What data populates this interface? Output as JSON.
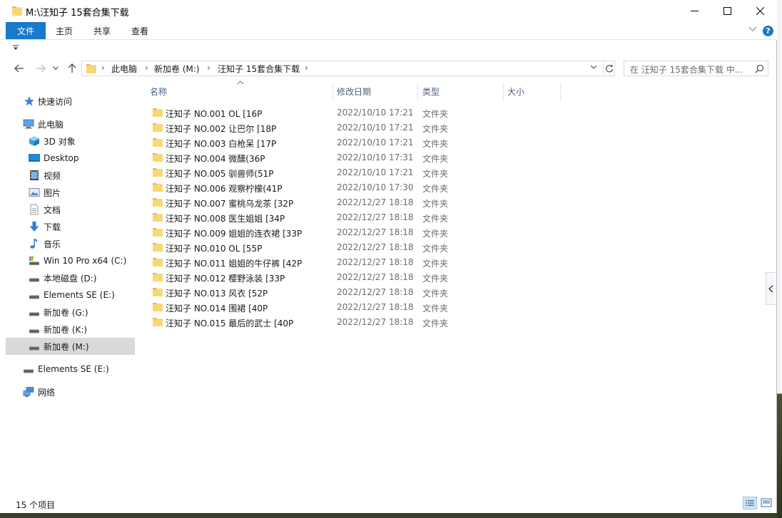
{
  "window": {
    "title": "M:\\汪知子 15套合集下载",
    "controls": {
      "minimize": "minimize",
      "maximize": "maximize",
      "close": "close"
    }
  },
  "ribbon": {
    "tabs": [
      "文件",
      "主页",
      "共享",
      "查看"
    ],
    "help": "?"
  },
  "address": {
    "crumbs": [
      "此电脑",
      "新加卷 (M:)",
      "汪知子 15套合集下载"
    ],
    "separator": "›"
  },
  "search": {
    "placeholder": "在 汪知子 15套合集下载 中..."
  },
  "sidebar": {
    "items": [
      {
        "label": "快速访问",
        "icon": "star-icon"
      },
      {
        "label": "此电脑",
        "icon": "computer-icon"
      },
      {
        "label": "3D 对象",
        "icon": "cube-icon"
      },
      {
        "label": "Desktop",
        "icon": "desktop-icon"
      },
      {
        "label": "视频",
        "icon": "video-icon"
      },
      {
        "label": "图片",
        "icon": "picture-icon"
      },
      {
        "label": "文档",
        "icon": "document-icon"
      },
      {
        "label": "下载",
        "icon": "download-icon"
      },
      {
        "label": "音乐",
        "icon": "music-icon"
      },
      {
        "label": "Win 10 Pro x64 (C:)",
        "icon": "system-drive-icon"
      },
      {
        "label": "本地磁盘 (D:)",
        "icon": "drive-icon"
      },
      {
        "label": "Elements SE (E:)",
        "icon": "drive-icon"
      },
      {
        "label": "新加卷 (G:)",
        "icon": "drive-icon"
      },
      {
        "label": "新加卷 (K:)",
        "icon": "drive-icon"
      },
      {
        "label": "新加卷 (M:)",
        "icon": "drive-icon"
      },
      {
        "label": "Elements SE (E:)",
        "icon": "drive-icon"
      },
      {
        "label": "网络",
        "icon": "network-icon"
      }
    ],
    "selected": "新加卷 (M:)"
  },
  "columns": [
    "名称",
    "修改日期",
    "类型",
    "大小"
  ],
  "files": [
    {
      "name": "汪知子 NO.001 OL [16P",
      "date": "2022/10/10 17:21",
      "type": "文件夹"
    },
    {
      "name": "汪知子 NO.002 让巴尔 [18P",
      "date": "2022/10/10 17:21",
      "type": "文件夹"
    },
    {
      "name": "汪知子 NO.003 白枪呆 [17P",
      "date": "2022/10/10 17:21",
      "type": "文件夹"
    },
    {
      "name": "汪知子 NO.004 微醺(36P",
      "date": "2022/10/10 17:31",
      "type": "文件夹"
    },
    {
      "name": "汪知子 NO.005 驯兽师(51P",
      "date": "2022/10/10 17:21",
      "type": "文件夹"
    },
    {
      "name": "汪知子 NO.006 观察柠檬(41P",
      "date": "2022/10/10 17:30",
      "type": "文件夹"
    },
    {
      "name": "汪知子 NO.007 蜜桃乌龙茶 [32P",
      "date": "2022/12/27 18:18",
      "type": "文件夹"
    },
    {
      "name": "汪知子 NO.008 医生姐姐 [34P",
      "date": "2022/12/27 18:18",
      "type": "文件夹"
    },
    {
      "name": "汪知子 NO.009 姐姐的连衣裙 [33P",
      "date": "2022/12/27 18:18",
      "type": "文件夹"
    },
    {
      "name": "汪知子 NO.010 OL [55P",
      "date": "2022/12/27 18:18",
      "type": "文件夹"
    },
    {
      "name": "汪知子 NO.011 姐姐的牛仔裤 [42P",
      "date": "2022/12/27 18:18",
      "type": "文件夹"
    },
    {
      "name": "汪知子 NO.012 樱野泳装 [33P",
      "date": "2022/12/27 18:18",
      "type": "文件夹"
    },
    {
      "name": "汪知子 NO.013 风衣 [52P",
      "date": "2022/12/27 18:18",
      "type": "文件夹"
    },
    {
      "name": "汪知子 NO.014 围裙 [40P",
      "date": "2022/12/27 18:18",
      "type": "文件夹"
    },
    {
      "name": "汪知子 NO.015 最后的武士 [40P",
      "date": "2022/12/27 18:18",
      "type": "文件夹"
    }
  ],
  "status": {
    "count": "15 个项目"
  },
  "colors": {
    "accent": "#1979ca",
    "folder": "#f8d775",
    "folder_dark": "#e8b84a",
    "selected": "#d9d9d9",
    "header_text": "#4c607a"
  }
}
